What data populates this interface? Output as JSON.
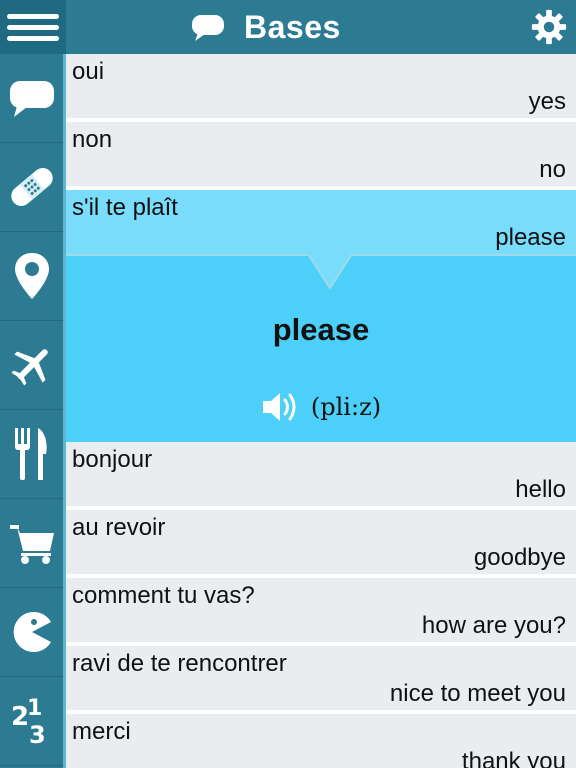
{
  "header": {
    "title": "Bases",
    "title_icon": "speech-bubble-icon",
    "menu_icon": "hamburger-menu-icon",
    "settings_icon": "gear-icon"
  },
  "sidebar": {
    "items": [
      {
        "name": "basics",
        "icon": "speech-bubble-icon"
      },
      {
        "name": "health",
        "icon": "bandage-icon"
      },
      {
        "name": "directions",
        "icon": "map-pin-icon"
      },
      {
        "name": "travel",
        "icon": "airplane-icon"
      },
      {
        "name": "food",
        "icon": "fork-knife-icon"
      },
      {
        "name": "shopping",
        "icon": "shopping-cart-icon"
      },
      {
        "name": "games",
        "icon": "pacman-icon"
      },
      {
        "name": "numbers",
        "icon": "numbers-icon"
      }
    ]
  },
  "phrases": [
    {
      "fr": "oui",
      "en": "yes"
    },
    {
      "fr": "non",
      "en": "no"
    },
    {
      "fr": "s'il te plaît",
      "en": "please"
    },
    {
      "fr": "bonjour",
      "en": "hello"
    },
    {
      "fr": "au revoir",
      "en": "goodbye"
    },
    {
      "fr": "comment tu vas?",
      "en": "how are you?"
    },
    {
      "fr": "ravi de te rencontrer",
      "en": "nice to meet you"
    },
    {
      "fr": "merci",
      "en": "thank you"
    }
  ],
  "detail": {
    "word": "please",
    "pronunciation": "(pli:z)",
    "speaker_icon": "speaker-icon"
  },
  "colors": {
    "bar": "#2d7b93",
    "selected_row": "#7adcfb",
    "detail_bg": "#4ccff9",
    "row_bg": "#e9edf0"
  }
}
